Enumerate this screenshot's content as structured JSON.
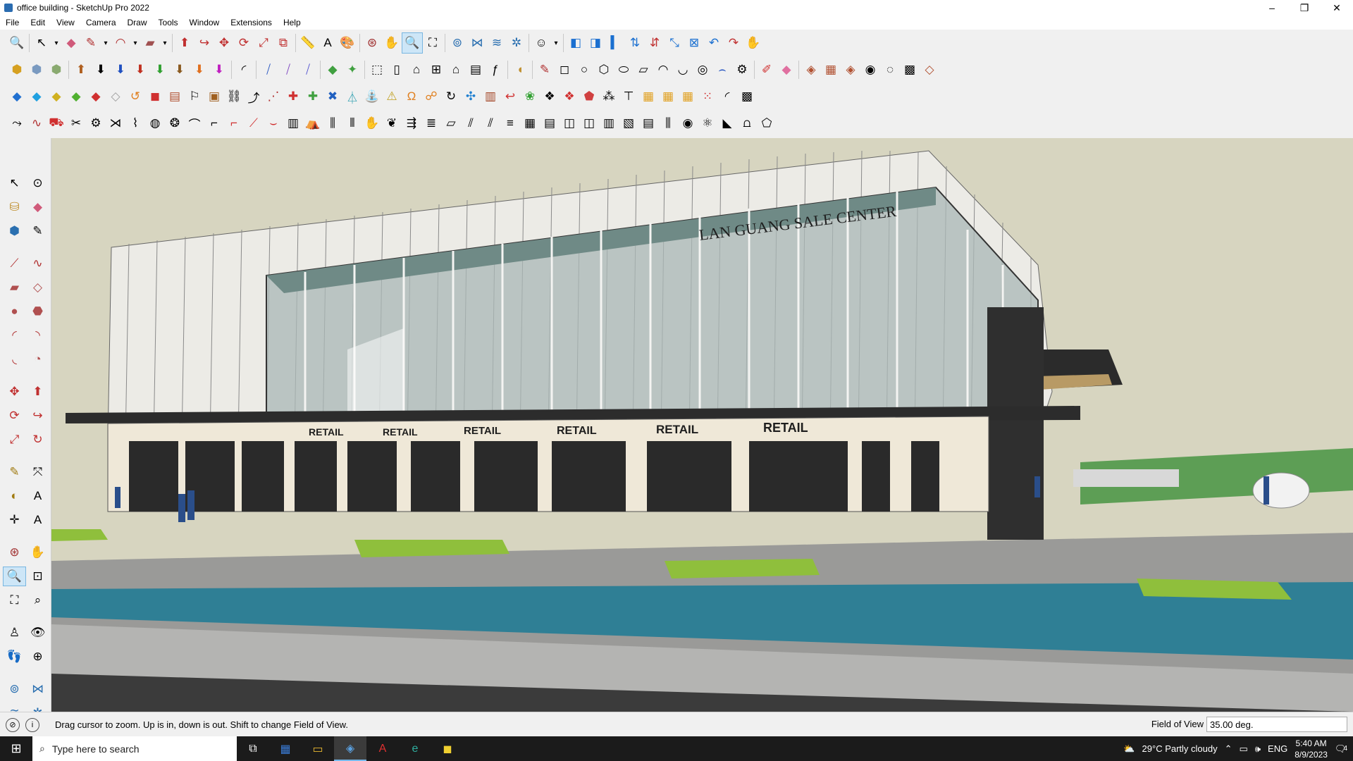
{
  "window": {
    "title": "office building - SketchUp Pro 2022",
    "minimize": "–",
    "maximize": "❐",
    "close": "✕"
  },
  "menu": [
    "File",
    "Edit",
    "View",
    "Camera",
    "Draw",
    "Tools",
    "Window",
    "Extensions",
    "Help"
  ],
  "scene": {
    "sign_main": "LAN GUANG SALE CENTER",
    "retail_label": "RETAIL"
  },
  "statusbar": {
    "hint": "Drag cursor to zoom.  Up is in, down is out. Shift to change Field of View.",
    "vcb_label": "Field of View",
    "vcb_value": "35.00 deg."
  },
  "taskbar": {
    "search_placeholder": "Type here to search",
    "weather": "29°C  Partly cloudy",
    "language": "ENG",
    "time": "5:40 AM",
    "date": "8/9/2023",
    "notifications": "4"
  },
  "colors": {
    "sky": "#d7d5c0",
    "glass": "#a9b7b5",
    "water": "#2f7f95",
    "taskbar": "#1b1b1b"
  }
}
